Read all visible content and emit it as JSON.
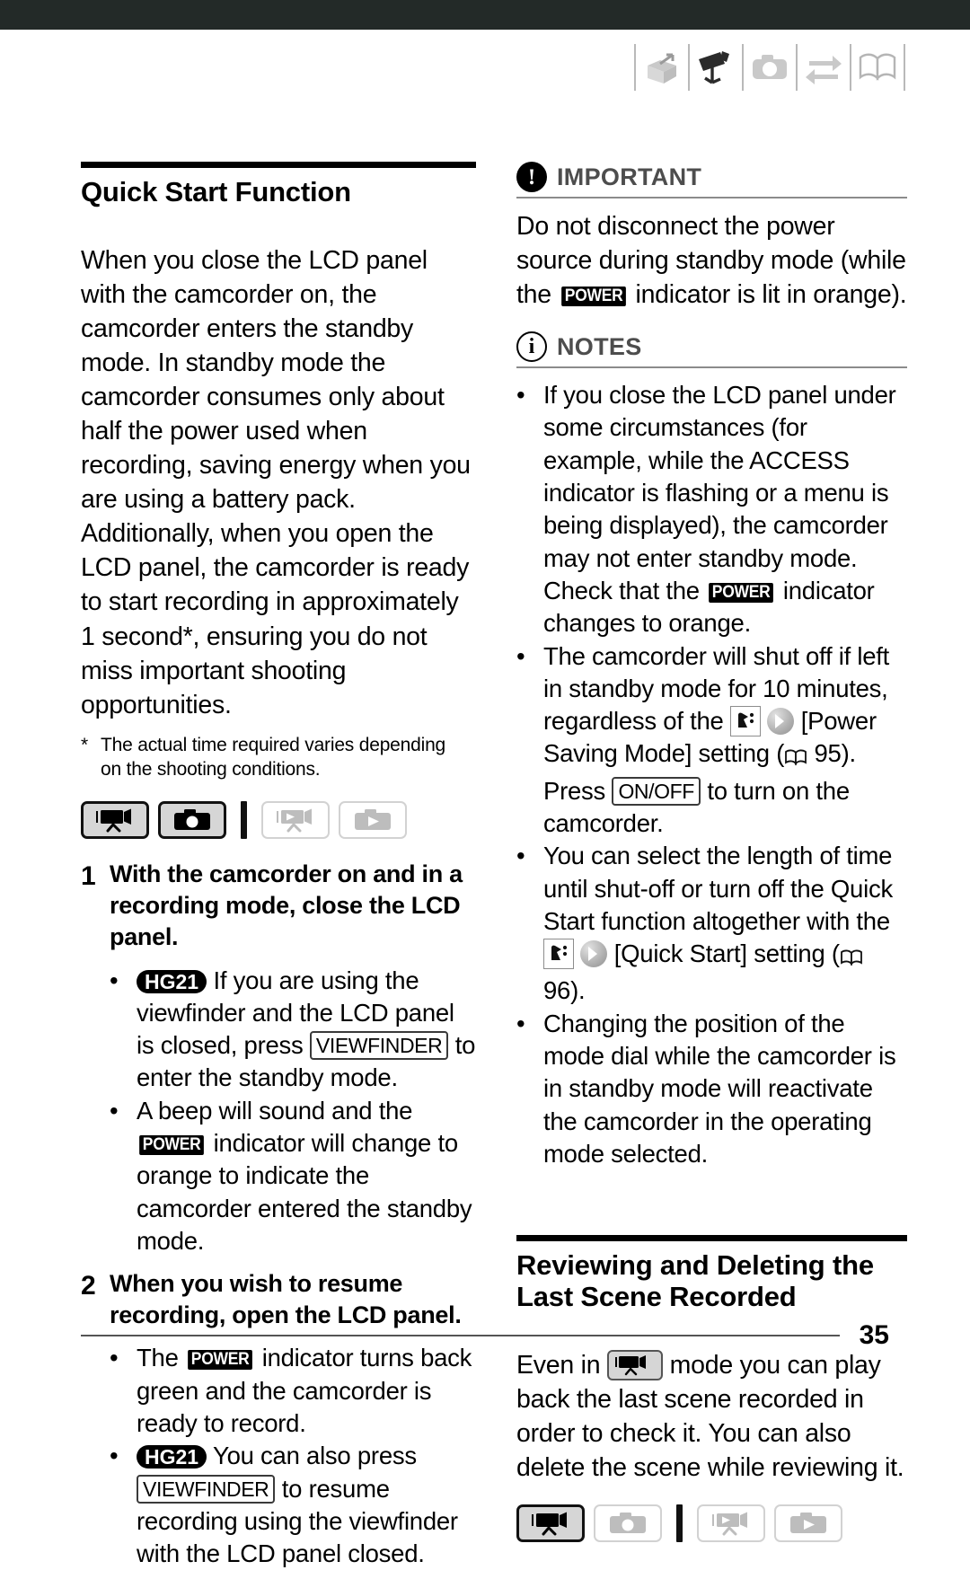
{
  "page": {
    "number": "35"
  },
  "header": {
    "icons": [
      {
        "name": "intro-box-icon",
        "state": "inactive"
      },
      {
        "name": "camcorder-icon",
        "state": "active"
      },
      {
        "name": "photo-camera-icon",
        "state": "inactive"
      },
      {
        "name": "transfer-arrows-icon",
        "state": "inactive"
      },
      {
        "name": "open-book-icon",
        "state": "inactive"
      }
    ]
  },
  "left": {
    "heading": "Quick Start Function",
    "intro": "When you close the LCD panel with the camcorder on, the camcorder enters the standby mode. In standby mode the camcorder consumes only about half the power used when recording, saving energy when you are using a battery pack. Additionally, when you open the LCD panel, the camcorder is ready to start recording in approximately 1 second*, ensuring you do not miss important shooting opportunities.",
    "footnote_marker": "*",
    "footnote": "The actual time required varies depending on the shooting conditions.",
    "mode_bar": [
      {
        "icon": "movie-record-icon",
        "state": "active"
      },
      {
        "icon": "photo-record-icon",
        "state": "active"
      },
      {
        "divider": true
      },
      {
        "icon": "movie-playback-icon",
        "state": "inactive"
      },
      {
        "icon": "photo-playback-icon",
        "state": "inactive"
      }
    ],
    "steps": [
      {
        "number": "1",
        "text": "With the camcorder on and in a recording mode, close the LCD panel.",
        "bullets": [
          {
            "badge": "HG21",
            "parts": [
              "If you are using the viewfinder and the LCD panel is closed, press ",
              "VIEWFINDER",
              " to enter the standby mode."
            ],
            "key": "VIEWFINDER",
            "before": "If you are using the viewfinder and the LCD panel is closed, press",
            "after": "to enter the standby mode."
          },
          {
            "badge": null,
            "before": "A beep will sound and the",
            "key": "POWER",
            "after": "indicator will change to orange to indicate the camcorder entered the standby mode."
          }
        ]
      },
      {
        "number": "2",
        "text": "When you wish to resume recording, open the LCD panel.",
        "bullets": [
          {
            "badge": null,
            "before": "The",
            "key": "POWER",
            "after": "indicator turns back green and the camcorder is ready to record."
          },
          {
            "badge": "HG21",
            "before": "You can also press",
            "key": "VIEWFINDER",
            "after": "to resume recording using the viewfinder with the LCD panel closed."
          }
        ]
      }
    ]
  },
  "right": {
    "important": {
      "title": "IMPORTANT",
      "icon": "exclamation-circle-icon",
      "text_before": "Do not disconnect the power source during standby mode (while the",
      "badge": "POWER",
      "text_after": "indicator is lit in orange)."
    },
    "notes": {
      "title": "NOTES",
      "icon": "info-circle-icon",
      "items": [
        {
          "before": "If you close the LCD panel under some circumstances (for example, while the ACCESS indicator is flashing or a menu is being displayed), the camcorder may not enter standby mode. Check that the",
          "badge": "POWER",
          "after": "indicator changes to orange."
        },
        {
          "before": "The camcorder will shut off if left in standby mode for 10 minutes, regardless of the",
          "menu_icon": "wrench-menu-icon",
          "arrow_icon": "gray-arrow-circle-icon",
          "setting": "[Power Saving Mode] setting (",
          "page_ref_icon": "book-page-icon",
          "page_ref": "95",
          "mid": "). Press",
          "key": "ON/OFF",
          "after": "to turn on the camcorder."
        },
        {
          "before": "You can select the length of time until shut-off or turn off the Quick Start function altogether with the",
          "menu_icon": "wrench-menu-icon",
          "arrow_icon": "gray-arrow-circle-icon",
          "setting": "[Quick Start] setting (",
          "page_ref_icon": "book-page-icon",
          "page_ref": "96",
          "after": ")."
        },
        {
          "before": "Changing the position of the mode dial while the camcorder is in standby mode will reactivate the camcorder in the operating mode selected.",
          "badge": null,
          "after": ""
        }
      ]
    },
    "section2": {
      "heading": "Reviewing and Deleting the Last Scene Recorded",
      "body_before": "Even in",
      "mode_icon": "movie-record-mode-icon",
      "body_after": "mode you can play back the last scene recorded in order to check it. You can also delete the scene while reviewing it.",
      "mode_bar": [
        {
          "icon": "movie-record-icon",
          "state": "active"
        },
        {
          "icon": "photo-record-icon",
          "state": "inactive"
        },
        {
          "divider": true
        },
        {
          "icon": "movie-playback-icon",
          "state": "inactive"
        },
        {
          "icon": "photo-playback-icon",
          "state": "inactive"
        }
      ]
    }
  }
}
